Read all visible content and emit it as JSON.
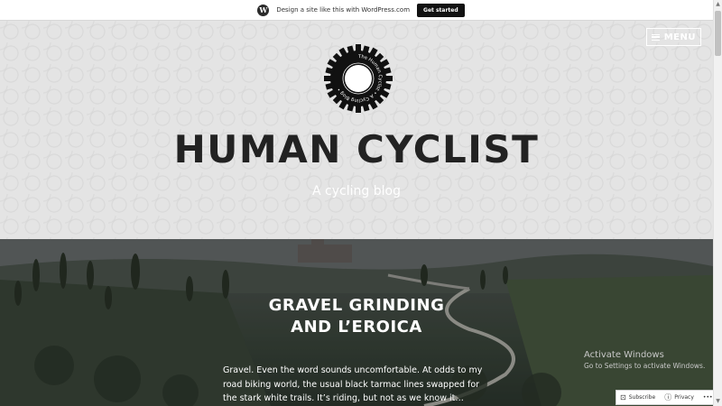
{
  "wpbar": {
    "logo_glyph": "W",
    "text": "Design a site like this with WordPress.com",
    "button": "Get started"
  },
  "header": {
    "menu_label": "MENU",
    "logo_ring_text": "The Human Cyclist • A Cycling Blog •",
    "title": "HUMAN CYCLIST",
    "tagline": "A cycling blog"
  },
  "post": {
    "title_line1": "GRAVEL GRINDING",
    "title_line2": "AND L’EROICA",
    "excerpt": "Gravel. Even the word sounds uncomfortable. At odds to my road biking world, the usual black tarmac lines swapped for the stark white trails. It’s riding, but not as we know it…"
  },
  "watermark": {
    "line1": "Activate Windows",
    "line2": "Go to Settings to activate Windows."
  },
  "actions": {
    "subscribe": "Subscribe",
    "privacy": "Privacy",
    "more": "•••"
  },
  "colors": {
    "wp_button_bg": "#111111",
    "title": "#222222",
    "header_bg": "#e4e4e4"
  },
  "icons": {
    "wp": "wordpress-icon",
    "menu": "hamburger-icon",
    "logo": "cog-logo",
    "subscribe": "subscribe-icon",
    "privacy": "info-icon"
  }
}
